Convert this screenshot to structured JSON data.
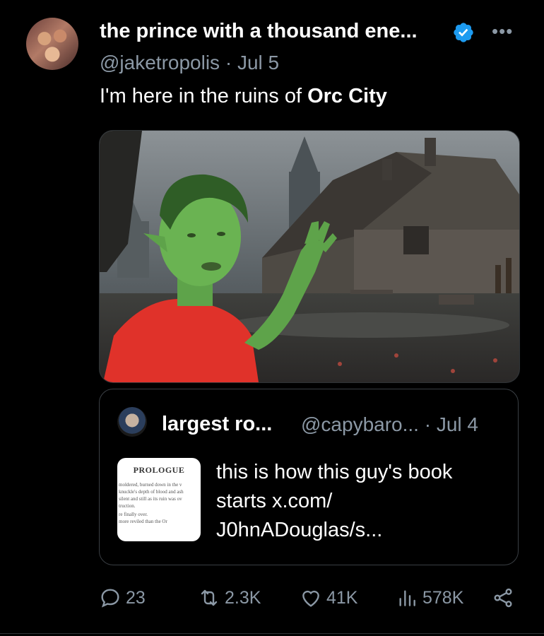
{
  "tweet": {
    "author_name": "the prince with a thousand ene...",
    "handle": "@jaketropolis",
    "date": "Jul 5",
    "text_prefix": "I'm here in the ruins of ",
    "text_bold": "Orc City"
  },
  "quote": {
    "author_name": "largest ro...",
    "handle_date": "@capybaro... · Jul 4",
    "text": "this is how this guy's book starts  x.com/ J0hnADouglas/s...",
    "thumbnail": {
      "title": "PROLOGUE",
      "lines": [
        "moldered, burned down in the v",
        "knuckle's depth of blood and ash",
        "silent and still as its ruin was ov",
        "truction.",
        "re finally over.",
        "more reviled than the Or"
      ]
    }
  },
  "actions": {
    "replies": "23",
    "reposts": "2.3K",
    "likes": "41K",
    "views": "578K"
  },
  "colors": {
    "background": "#000000",
    "text_primary": "#ffffff",
    "text_secondary": "#8b98a5",
    "verified": "#1d9bf0",
    "border": "#2f3336"
  }
}
